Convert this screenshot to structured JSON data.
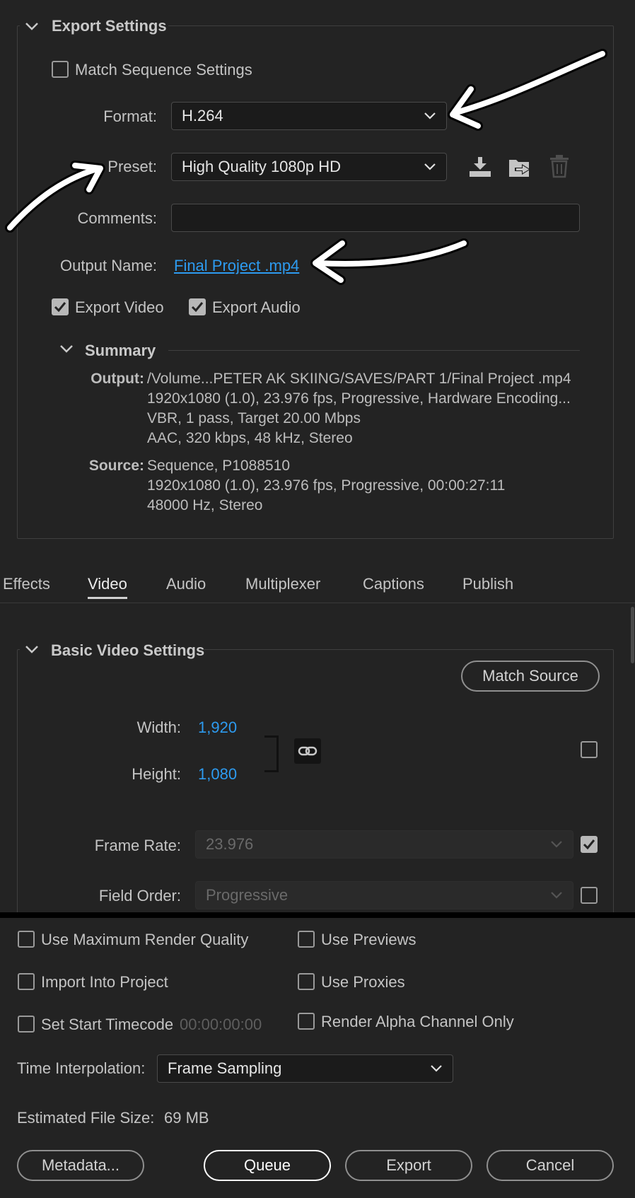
{
  "export_settings": {
    "header": "Export Settings",
    "match_sequence_label": "Match Sequence Settings",
    "format_label": "Format:",
    "format_value": "H.264",
    "preset_label": "Preset:",
    "preset_value": "High Quality 1080p HD",
    "comments_label": "Comments:",
    "comments_value": "",
    "output_name_label": "Output Name:",
    "output_name_value": "Final Project .mp4",
    "export_video_label": "Export Video",
    "export_audio_label": "Export Audio",
    "icons": [
      "save-preset-icon",
      "import-preset-icon",
      "delete-preset-icon"
    ]
  },
  "summary": {
    "header": "Summary",
    "output_label": "Output:",
    "output_lines": [
      "/Volume...PETER AK SKIING/SAVES/PART 1/Final Project .mp4",
      "1920x1080 (1.0), 23.976 fps, Progressive, Hardware Encoding...",
      "VBR, 1 pass, Target 20.00 Mbps",
      "AAC, 320 kbps, 48 kHz, Stereo"
    ],
    "source_label": "Source:",
    "source_lines": [
      "Sequence, P1088510",
      "1920x1080 (1.0), 23.976 fps, Progressive, 00:00:27:11",
      "48000 Hz, Stereo"
    ]
  },
  "tabs": [
    {
      "label": "Effects",
      "active": false
    },
    {
      "label": "Video",
      "active": true
    },
    {
      "label": "Audio",
      "active": false
    },
    {
      "label": "Multiplexer",
      "active": false
    },
    {
      "label": "Captions",
      "active": false
    },
    {
      "label": "Publish",
      "active": false
    }
  ],
  "basic_video": {
    "header": "Basic Video Settings",
    "match_source_label": "Match Source",
    "width_label": "Width:",
    "width_value": "1,920",
    "height_label": "Height:",
    "height_value": "1,080",
    "frame_rate_label": "Frame Rate:",
    "frame_rate_value": "23.976",
    "field_order_label": "Field Order:",
    "field_order_value": "Progressive"
  },
  "options": {
    "max_render_quality": "Use Maximum Render Quality",
    "use_previews": "Use Previews",
    "import_into_project": "Import Into Project",
    "use_proxies": "Use Proxies",
    "set_start_timecode": "Set Start Timecode",
    "start_timecode_value": "00:00:00:00",
    "render_alpha_only": "Render Alpha Channel Only",
    "time_interpolation_label": "Time Interpolation:",
    "time_interpolation_value": "Frame Sampling",
    "estimated_size_label": "Estimated File Size:",
    "estimated_size_value": "69 MB"
  },
  "buttons": {
    "metadata": "Metadata...",
    "queue": "Queue",
    "export": "Export",
    "cancel": "Cancel"
  },
  "colors": {
    "background": "#232323",
    "link": "#2d9bf0",
    "annotation_arrow": "#ffffff"
  }
}
